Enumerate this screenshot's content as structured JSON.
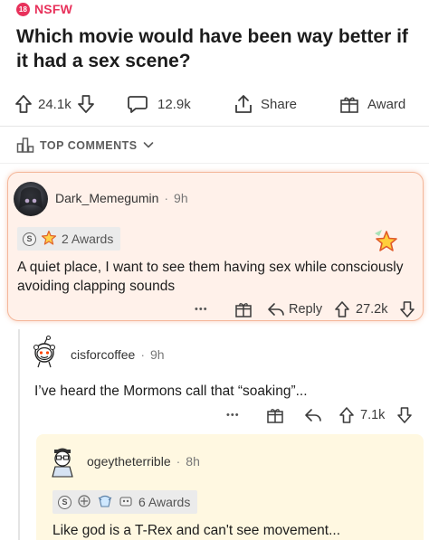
{
  "post": {
    "nsfw_badge": "18",
    "nsfw_label": "NSFW",
    "title": "Which movie would have been way better if it had a sex scene?",
    "upvotes": "24.1k",
    "comments": "12.9k",
    "share_label": "Share",
    "award_label": "Award"
  },
  "sort": {
    "label": "TOP COMMENTS"
  },
  "comments": [
    {
      "user": "Dark_Memegumin",
      "time": "9h",
      "awards_count": "2 Awards",
      "coin_letter": "S",
      "body": "A quiet place, I want to see them having sex while consciously avoiding clapping sounds",
      "more": "•••",
      "reply_label": "Reply",
      "score": "27.2k"
    },
    {
      "user": "cisforcoffee",
      "time": "9h",
      "body": "I’ve heard the Mormons call that “soaking”...",
      "more": "•••",
      "score": "7.1k"
    },
    {
      "user": "ogeytheterrible",
      "time": "8h",
      "awards_count": "6 Awards",
      "coin_letter": "S",
      "body": "Like god is a T-Rex and can't see movement..."
    }
  ],
  "colors": {
    "nsfw": "#e8315b",
    "highlight_bg": "#fff1ea",
    "highlight_border": "#f4b79a",
    "nested_bg": "#fff8e1"
  }
}
